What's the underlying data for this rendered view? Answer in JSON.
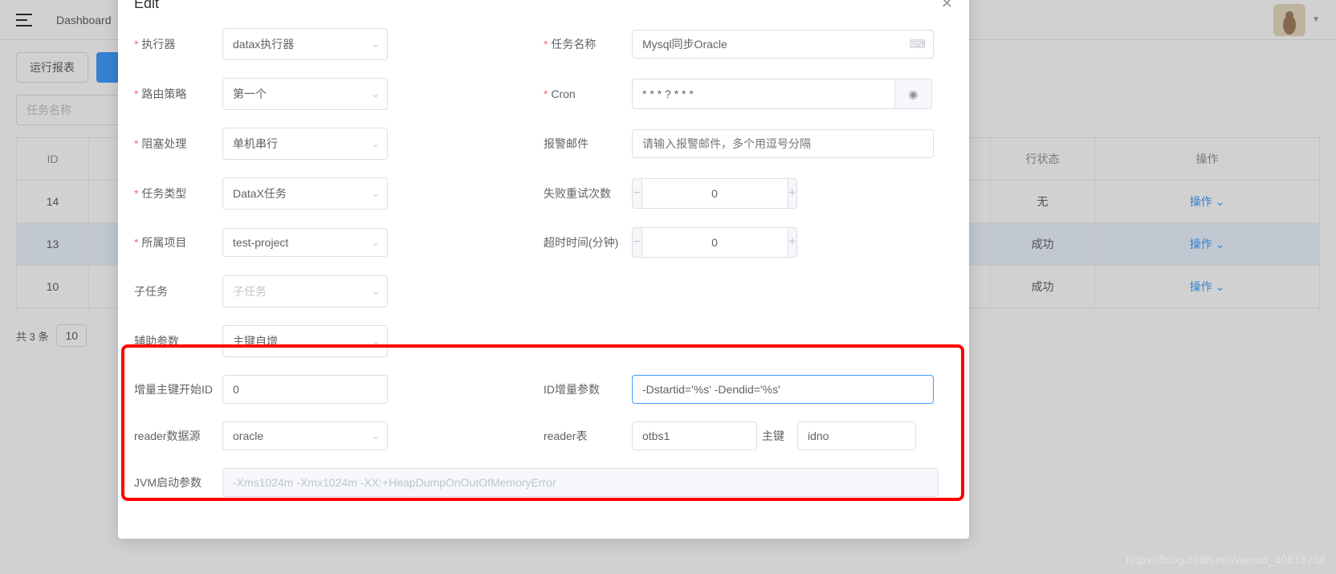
{
  "topbar": {
    "breadcrumb": "Dashboard"
  },
  "page": {
    "run_report_btn": "运行报表",
    "task_name_placeholder": "任务名称",
    "total_text": "共 3 条",
    "page_size": "10"
  },
  "table": {
    "headers": {
      "id": "ID",
      "status": "行状态",
      "op": "操作"
    },
    "rows": [
      {
        "id": "14",
        "status": "无",
        "op": "操作"
      },
      {
        "id": "13",
        "status": "成功",
        "op": "操作"
      },
      {
        "id": "10",
        "status": "成功",
        "op": "操作"
      }
    ]
  },
  "modal": {
    "title": "Edit",
    "labels": {
      "executor": "执行器",
      "route": "路由策略",
      "block": "阻塞处理",
      "task_type": "任务类型",
      "project": "所属项目",
      "subtask": "子任务",
      "task_name": "任务名称",
      "cron": "Cron",
      "alarm_email": "报警邮件",
      "retry": "失败重试次数",
      "timeout": "超时时间(分钟)",
      "aux_param": "辅助参数",
      "start_id": "增量主键开始ID",
      "id_param": "ID增量参数",
      "reader_ds": "reader数据源",
      "reader_table": "reader表",
      "pk": "主键",
      "jvm": "JVM启动参数"
    },
    "values": {
      "executor": "datax执行器",
      "route": "第一个",
      "block": "单机串行",
      "task_type": "DataX任务",
      "project": "test-project",
      "subtask_placeholder": "子任务",
      "task_name": "Mysql同步Oracle",
      "cron": "* * * ? * * *",
      "alarm_email_placeholder": "请输入报警邮件，多个用逗号分隔",
      "retry": "0",
      "timeout": "0",
      "aux_param": "主键自增",
      "start_id": "0",
      "id_param": "-Dstartid='%s' -Dendid='%s'",
      "reader_ds": "oracle",
      "reader_table": "otbs1",
      "pk": "idno",
      "jvm": "-Xms1024m -Xmx1024m -XX:+HeapDumpOnOutOfMemoryError"
    }
  },
  "watermark": "https://blog.csdn.net/weixin_40816738"
}
